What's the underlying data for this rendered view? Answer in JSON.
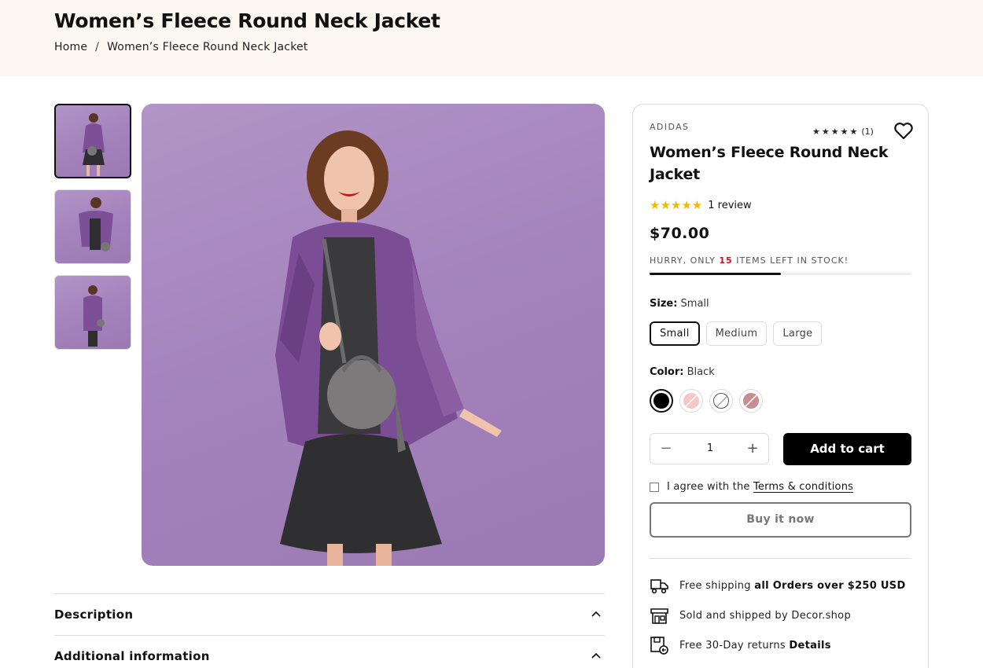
{
  "header": {
    "title": "Women’s Fleece Round Neck Jacket",
    "breadcrumb": {
      "home": "Home",
      "separator": "/",
      "current": "Women’s Fleece Round Neck Jacket"
    }
  },
  "gallery": {
    "thumbnails": [
      "Product image 1",
      "Product image 2",
      "Product image 3"
    ],
    "active_index": 0
  },
  "accordion": [
    {
      "title": "Description"
    },
    {
      "title": "Additional information"
    }
  ],
  "product": {
    "brand": "ADIDAS",
    "top_rating": {
      "stars": "★★★★★",
      "count": "(1)"
    },
    "title": "Women’s Fleece Round Neck Jacket",
    "rating_stars": "★★★★★",
    "review_text": "1 review",
    "price": "$70.00",
    "stock": {
      "prefix": "HURRY, ONLY ",
      "count": "15",
      "suffix": " ITEMS LEFT IN STOCK!",
      "progress": 0.5
    },
    "size": {
      "label": "Size:",
      "selected": "Small",
      "options": [
        "Small",
        "Medium",
        "Large"
      ]
    },
    "color": {
      "label": "Color:",
      "selected": "Black",
      "swatches": [
        "#000000",
        "#f6c6c8",
        "#ffffff",
        "#c98c91"
      ]
    },
    "quantity": {
      "minus": "−",
      "value": "1",
      "plus": "+"
    },
    "add_to_cart": "Add to cart",
    "terms": {
      "text": "I agree with the ",
      "link": "Terms & conditions"
    },
    "buy_now": "Buy it now",
    "info": [
      {
        "icon": "truck-icon",
        "text": "Free shipping ",
        "bold": "all Orders over $250 USD"
      },
      {
        "icon": "store-icon",
        "text": "Sold and shipped by Decor.shop",
        "bold": ""
      },
      {
        "icon": "return-box-icon",
        "text": "Free 30-Day returns ",
        "bold": "Details"
      }
    ]
  }
}
